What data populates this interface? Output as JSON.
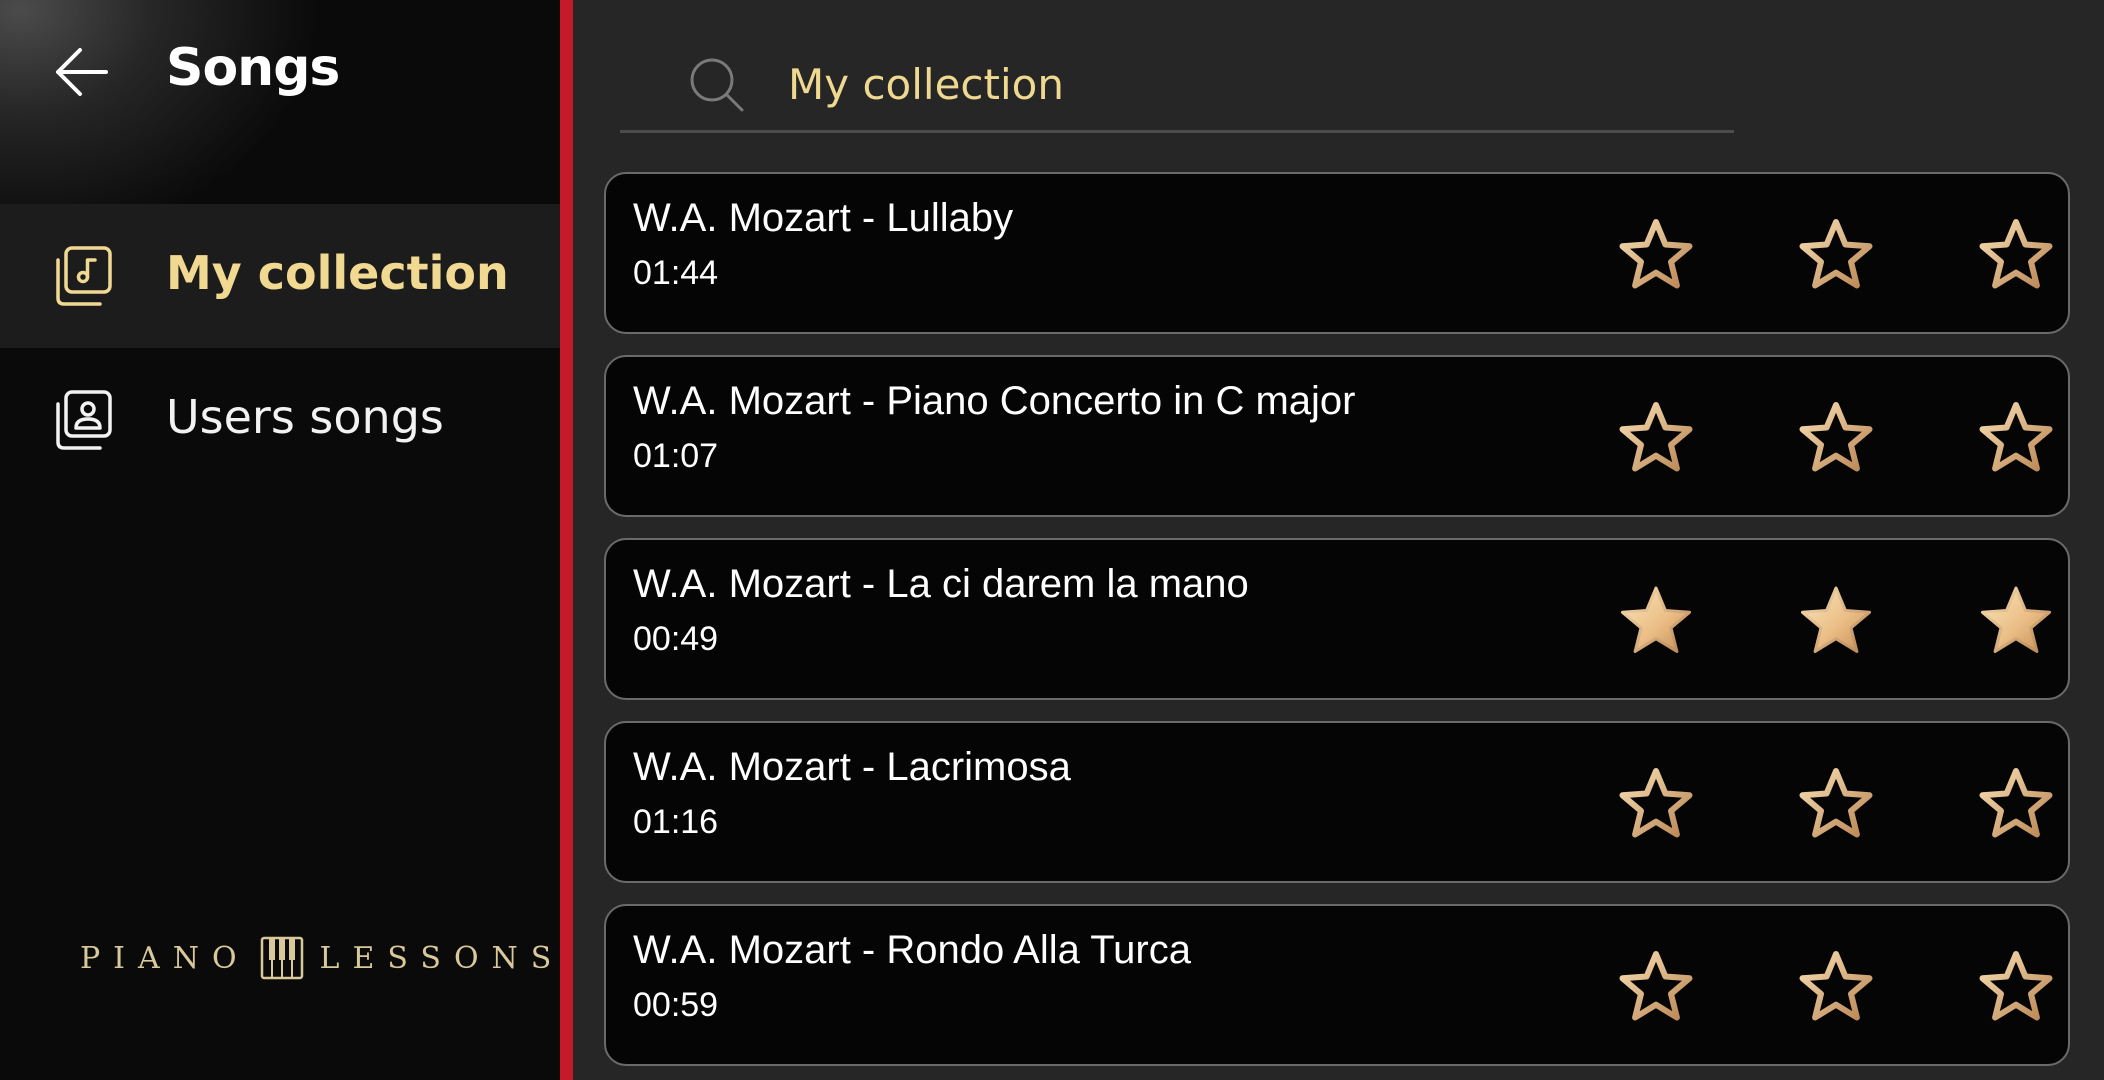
{
  "sidebar": {
    "title": "Songs",
    "items": [
      {
        "label": "My collection",
        "icon": "music-collection-icon",
        "active": true
      },
      {
        "label": "Users songs",
        "icon": "user-collection-icon",
        "active": false
      }
    ],
    "brand": {
      "left": "PIANO",
      "right": "LESSONS",
      "icon": "piano-keys-icon"
    }
  },
  "search": {
    "value": "My collection",
    "icon": "search-icon"
  },
  "songs": [
    {
      "title": "W.A. Mozart - Lullaby",
      "duration": "01:44",
      "stars_filled": 0,
      "stars_total": 3
    },
    {
      "title": "W.A. Mozart - Piano Concerto in C major",
      "duration": "01:07",
      "stars_filled": 0,
      "stars_total": 3
    },
    {
      "title": "W.A. Mozart - La ci darem la mano",
      "duration": "00:49",
      "stars_filled": 3,
      "stars_total": 3
    },
    {
      "title": "W.A. Mozart - Lacrimosa",
      "duration": "01:16",
      "stars_filled": 0,
      "stars_total": 3
    },
    {
      "title": "W.A. Mozart - Rondo Alla Turca",
      "duration": "00:59",
      "stars_filled": 0,
      "stars_total": 3
    }
  ],
  "colors": {
    "accent": "#f1d992",
    "divider": "#c41a2a",
    "background": "#262626",
    "card": "#050505",
    "star_gold_light": "#f6dcaa",
    "star_gold_dark": "#c9935c"
  }
}
